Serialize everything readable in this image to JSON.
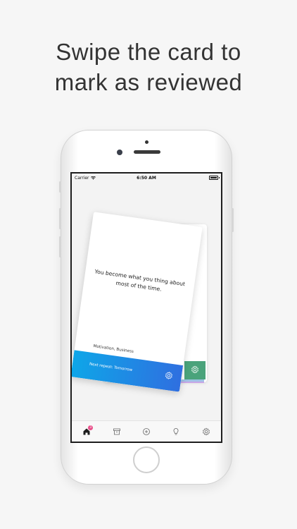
{
  "headline": {
    "line1": "Swipe the card to",
    "line2": "mark as reviewed"
  },
  "status_bar": {
    "carrier": "Carrier",
    "time": "6:50 AM",
    "battery_level": 1.0
  },
  "card": {
    "quote": "You become what you thing about most of the time.",
    "tags": "Motivation, Business",
    "next_repeat": "Next repeat: Tomorrow",
    "footer_color_start": "#0ea6e8",
    "footer_color_end": "#2f6fe0",
    "settings_icon": "gear-icon"
  },
  "back_card": {
    "footer_color": "#4aa37b",
    "settings_icon": "gear-icon"
  },
  "tab_bar": {
    "items": [
      {
        "name": "home",
        "icon": "home-icon",
        "badge": "3",
        "active": true
      },
      {
        "name": "archive",
        "icon": "archive-icon",
        "active": false
      },
      {
        "name": "add",
        "icon": "plus-circle-icon",
        "active": false
      },
      {
        "name": "ideas",
        "icon": "lightbulb-icon",
        "active": false
      },
      {
        "name": "settings",
        "icon": "gear-icon",
        "active": false
      }
    ],
    "badge_color": "#e8508a"
  }
}
